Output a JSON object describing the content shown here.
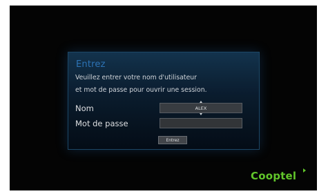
{
  "login": {
    "title": "Entrez",
    "instruction_line1": "Veuillez entrer votre nom d'utilisateur",
    "instruction_line2": "et mot de passe pour ouvrir une session.",
    "nom_label": "Nom",
    "nom_value": "ALEX",
    "mot_de_passe_label": "Mot de passe",
    "mot_de_passe_value": "",
    "submit_label": "Entrez"
  },
  "brand": {
    "name": "Cooptel"
  }
}
